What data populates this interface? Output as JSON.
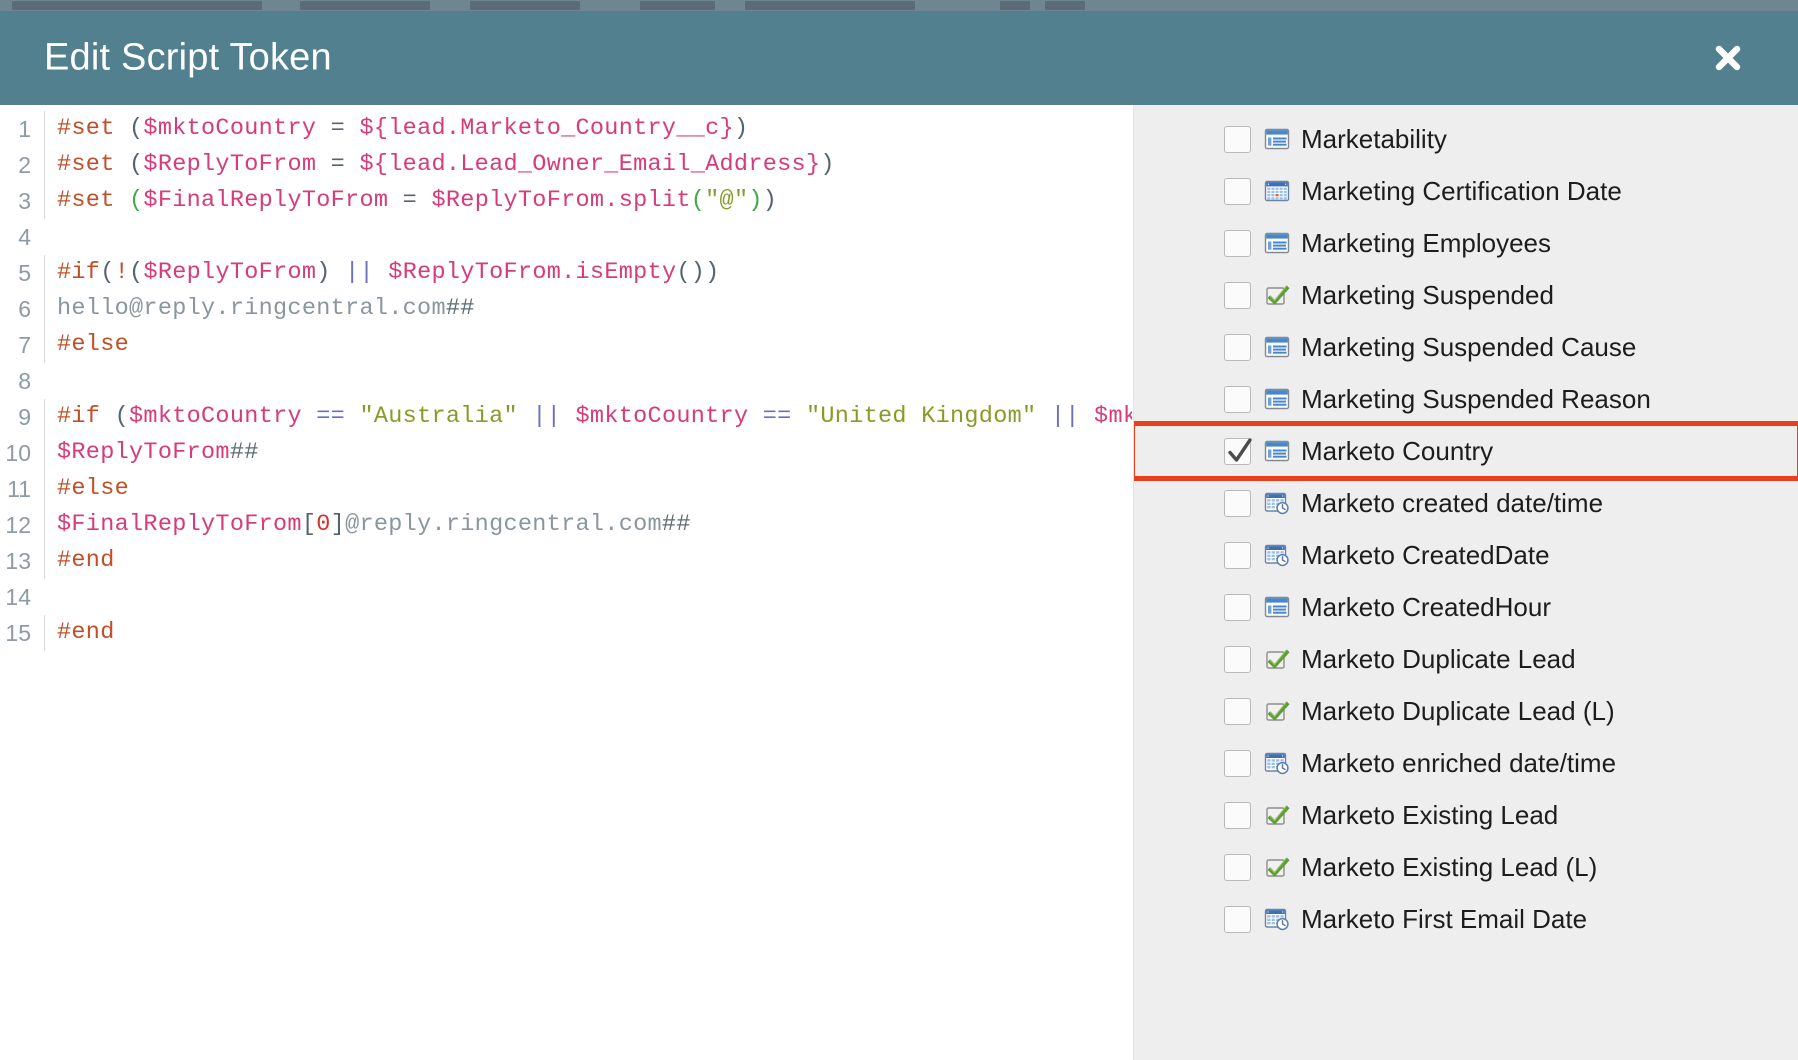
{
  "window": {
    "title": "Edit Script Token",
    "close_icon": "close-icon",
    "close_label": "Close"
  },
  "editor": {
    "language": "velocity",
    "total_lines": 15,
    "lines": [
      {
        "number": "1",
        "tokens": [
          {
            "t": "#set ",
            "c": "tok-dir"
          },
          {
            "t": "(",
            "c": "tok-punct"
          },
          {
            "t": "$mktoCountry",
            "c": "tok-var"
          },
          {
            "t": " = ",
            "c": "tok-punct"
          },
          {
            "t": "${lead.Marketo_Country__c}",
            "c": "tok-var"
          },
          {
            "t": ")",
            "c": "tok-punct"
          }
        ]
      },
      {
        "number": "2",
        "tokens": [
          {
            "t": "#set ",
            "c": "tok-dir"
          },
          {
            "t": "(",
            "c": "tok-punct"
          },
          {
            "t": "$ReplyToFrom",
            "c": "tok-var"
          },
          {
            "t": " = ",
            "c": "tok-punct"
          },
          {
            "t": "${lead.Lead_Owner_Email_Address}",
            "c": "tok-var"
          },
          {
            "t": ")",
            "c": "tok-punct"
          }
        ]
      },
      {
        "number": "3",
        "tokens": [
          {
            "t": "#set ",
            "c": "tok-dir"
          },
          {
            "t": "(",
            "c": "tok-fn"
          },
          {
            "t": "$FinalReplyToFrom",
            "c": "tok-var"
          },
          {
            "t": " = ",
            "c": "tok-punct"
          },
          {
            "t": "$ReplyToFrom.split",
            "c": "tok-var"
          },
          {
            "t": "(",
            "c": "tok-fn"
          },
          {
            "t": "\"@\"",
            "c": "tok-str"
          },
          {
            "t": ")",
            "c": "tok-fn"
          },
          {
            "t": ")",
            "c": "tok-punct"
          }
        ]
      },
      {
        "number": "4",
        "tokens": []
      },
      {
        "number": "5",
        "tokens": [
          {
            "t": "#if",
            "c": "tok-dir"
          },
          {
            "t": "(",
            "c": "tok-punct"
          },
          {
            "t": "!",
            "c": "tok-dir"
          },
          {
            "t": "(",
            "c": "tok-punct"
          },
          {
            "t": "$ReplyToFrom",
            "c": "tok-var"
          },
          {
            "t": ")",
            "c": "tok-punct"
          },
          {
            "t": " ",
            "c": "tok-punct"
          },
          {
            "t": "||",
            "c": "tok-op"
          },
          {
            "t": " ",
            "c": "tok-punct"
          },
          {
            "t": "$ReplyToFrom.isEmpty",
            "c": "tok-var"
          },
          {
            "t": "())",
            "c": "tok-punct"
          }
        ]
      },
      {
        "number": "6",
        "tokens": [
          {
            "t": "hello@reply.ringcentral.com",
            "c": "tok-plain"
          },
          {
            "t": "##",
            "c": "tok-cmt"
          }
        ]
      },
      {
        "number": "7",
        "tokens": [
          {
            "t": "#else",
            "c": "tok-dir"
          }
        ]
      },
      {
        "number": "8",
        "tokens": []
      },
      {
        "number": "9",
        "tokens": [
          {
            "t": "#if ",
            "c": "tok-dir"
          },
          {
            "t": "(",
            "c": "tok-punct"
          },
          {
            "t": "$mktoCountry",
            "c": "tok-var"
          },
          {
            "t": " ",
            "c": "tok-punct"
          },
          {
            "t": "==",
            "c": "tok-op"
          },
          {
            "t": " ",
            "c": "tok-punct"
          },
          {
            "t": "\"Australia\"",
            "c": "tok-str"
          },
          {
            "t": " ",
            "c": "tok-punct"
          },
          {
            "t": "||",
            "c": "tok-op"
          },
          {
            "t": " ",
            "c": "tok-punct"
          },
          {
            "t": "$mktoCountry",
            "c": "tok-var"
          },
          {
            "t": " ",
            "c": "tok-punct"
          },
          {
            "t": "==",
            "c": "tok-op"
          },
          {
            "t": " ",
            "c": "tok-punct"
          },
          {
            "t": "\"United Kingdom\"",
            "c": "tok-str"
          },
          {
            "t": " ",
            "c": "tok-punct"
          },
          {
            "t": "||",
            "c": "tok-op"
          },
          {
            "t": " ",
            "c": "tok-punct"
          },
          {
            "t": "$mktoCountry",
            "c": "tok-var"
          }
        ]
      },
      {
        "number": "10",
        "tokens": [
          {
            "t": "$ReplyToFrom",
            "c": "tok-var"
          },
          {
            "t": "##",
            "c": "tok-cmt"
          }
        ]
      },
      {
        "number": "11",
        "tokens": [
          {
            "t": "#else",
            "c": "tok-dir"
          }
        ]
      },
      {
        "number": "12",
        "tokens": [
          {
            "t": "$FinalReplyToFrom",
            "c": "tok-var"
          },
          {
            "t": "[",
            "c": "tok-punct"
          },
          {
            "t": "0",
            "c": "tok-num"
          },
          {
            "t": "]",
            "c": "tok-punct"
          },
          {
            "t": "@reply.ringcentral.com",
            "c": "tok-plain"
          },
          {
            "t": "##",
            "c": "tok-cmt"
          }
        ]
      },
      {
        "number": "13",
        "tokens": [
          {
            "t": "#end",
            "c": "tok-dir"
          }
        ]
      },
      {
        "number": "14",
        "tokens": []
      },
      {
        "number": "15",
        "tokens": [
          {
            "t": "#end",
            "c": "tok-dir"
          }
        ]
      }
    ]
  },
  "token_panel": {
    "items": [
      {
        "label": "Marketability",
        "icon": "text-field-icon",
        "checked": false,
        "selected": false
      },
      {
        "label": "Marketing Certification Date",
        "icon": "calendar-icon",
        "checked": false,
        "selected": false
      },
      {
        "label": "Marketing Employees",
        "icon": "text-field-icon",
        "checked": false,
        "selected": false
      },
      {
        "label": "Marketing Suspended",
        "icon": "boolean-check-icon",
        "checked": false,
        "selected": false
      },
      {
        "label": "Marketing Suspended Cause",
        "icon": "text-field-icon",
        "checked": false,
        "selected": false
      },
      {
        "label": "Marketing Suspended Reason",
        "icon": "text-field-icon",
        "checked": false,
        "selected": false
      },
      {
        "label": "Marketo Country",
        "icon": "text-field-icon",
        "checked": true,
        "selected": true
      },
      {
        "label": "Marketo created date/time",
        "icon": "datetime-icon",
        "checked": false,
        "selected": false
      },
      {
        "label": "Marketo CreatedDate",
        "icon": "datetime-icon",
        "checked": false,
        "selected": false
      },
      {
        "label": "Marketo CreatedHour",
        "icon": "text-field-icon",
        "checked": false,
        "selected": false
      },
      {
        "label": "Marketo Duplicate Lead",
        "icon": "boolean-check-icon",
        "checked": false,
        "selected": false
      },
      {
        "label": "Marketo Duplicate Lead (L)",
        "icon": "boolean-check-icon",
        "checked": false,
        "selected": false
      },
      {
        "label": "Marketo enriched date/time",
        "icon": "datetime-icon",
        "checked": false,
        "selected": false
      },
      {
        "label": "Marketo Existing Lead",
        "icon": "boolean-check-icon",
        "checked": false,
        "selected": false
      },
      {
        "label": "Marketo Existing Lead (L)",
        "icon": "boolean-check-icon",
        "checked": false,
        "selected": false
      },
      {
        "label": "Marketo First Email Date",
        "icon": "datetime-icon",
        "checked": false,
        "selected": false
      }
    ]
  },
  "colors": {
    "header_bg": "#52808f",
    "panel_bg": "#eeeeee",
    "selection_outline": "#e8401f",
    "editor_bg": "#ffffff",
    "gutter_text": "#8e9ba3"
  }
}
